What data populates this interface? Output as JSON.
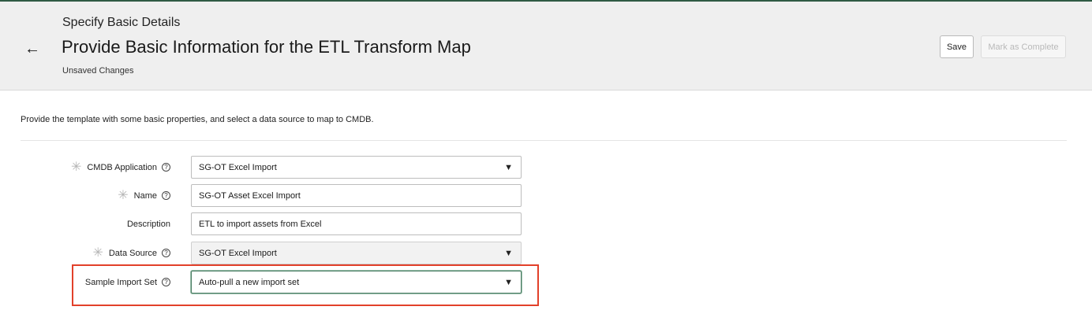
{
  "header": {
    "subtitle": "Specify Basic Details",
    "title": "Provide Basic Information for the ETL Transform Map",
    "status": "Unsaved Changes",
    "back_icon": "←",
    "save_label": "Save",
    "complete_label": "Mark as Complete"
  },
  "intro": "Provide the template with some basic properties, and select a data source to map to CMDB.",
  "form": {
    "help_icon": "?",
    "required_icon": "✳",
    "dropdown_icon": "▼",
    "cmdb_application": {
      "label": "CMDB Application",
      "value": "SG-OT Excel Import"
    },
    "name": {
      "label": "Name",
      "value": "SG-OT Asset Excel Import"
    },
    "description": {
      "label": "Description",
      "value": "ETL to import assets from Excel"
    },
    "data_source": {
      "label": "Data Source",
      "value": "SG-OT Excel Import"
    },
    "sample_import_set": {
      "label": "Sample Import Set",
      "value": "Auto-pull a new import set"
    }
  },
  "colors": {
    "highlight": "#e2402a",
    "focus": "#4a7d63",
    "header_bg": "#efefef"
  }
}
